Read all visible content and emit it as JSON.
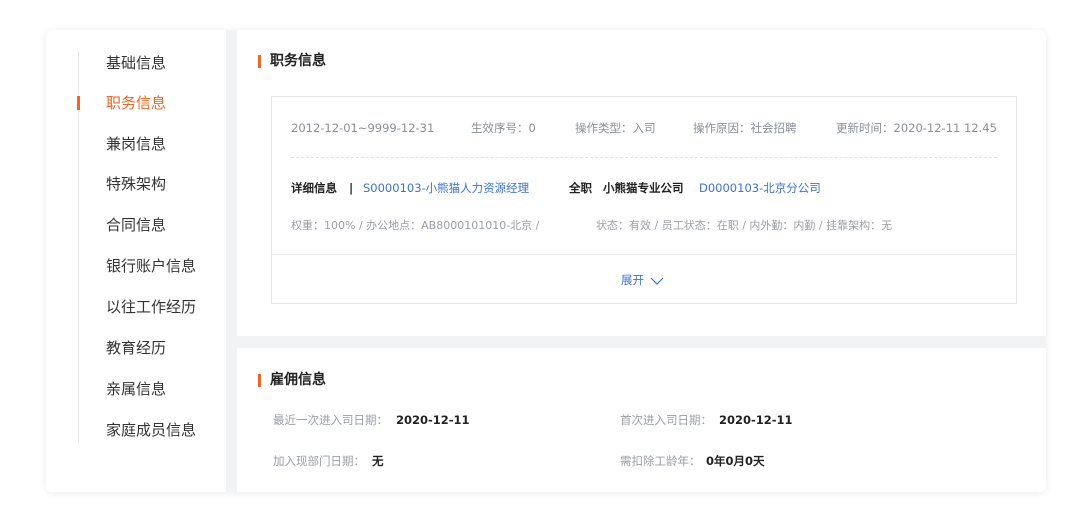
{
  "sidebar": {
    "items": [
      {
        "label": "基础信息"
      },
      {
        "label": "职务信息"
      },
      {
        "label": "兼岗信息"
      },
      {
        "label": "特殊架构"
      },
      {
        "label": "合同信息"
      },
      {
        "label": "银行账户信息"
      },
      {
        "label": "以往工作经历"
      },
      {
        "label": "教育经历"
      },
      {
        "label": "亲属信息"
      },
      {
        "label": "家庭成员信息"
      }
    ],
    "active_index": 1,
    "accent_color": "#f26522"
  },
  "position_section": {
    "title": "职务信息",
    "record": {
      "date_range": "2012-12-01~9999-12-31",
      "effective_seq": "生效序号：0",
      "operation_type": "操作类型：入司",
      "operation_reason": "操作原因：社会招聘",
      "updated_time": "更新时间：2020-12-11 12.45",
      "detail_label": "详细信息",
      "separator": "|",
      "position_link": "S0000103-小熊猫人力资源经理",
      "employment_type": "全职",
      "company": "小熊猫专业公司",
      "department_link": "D0000103-北京分公司",
      "sub_info_left": "权重：100% / 办公地点：AB8000101010-北京 /",
      "sub_info_right": "状态：有效 / 员工状态：在职  / 内外勤：内勤 / 挂靠架构：无"
    },
    "expand_label": "展开",
    "link_color": "#3d72d6"
  },
  "employment_section": {
    "title": "雇佣信息",
    "fields": [
      {
        "label": "最近一次进入司日期：",
        "value": "2020-12-11"
      },
      {
        "label": "首次进入司日期：",
        "value": "2020-12-11"
      },
      {
        "label": "加入现部门日期：",
        "value": "无"
      },
      {
        "label": "需扣除工龄年：",
        "value": "0年0月0天"
      }
    ]
  }
}
